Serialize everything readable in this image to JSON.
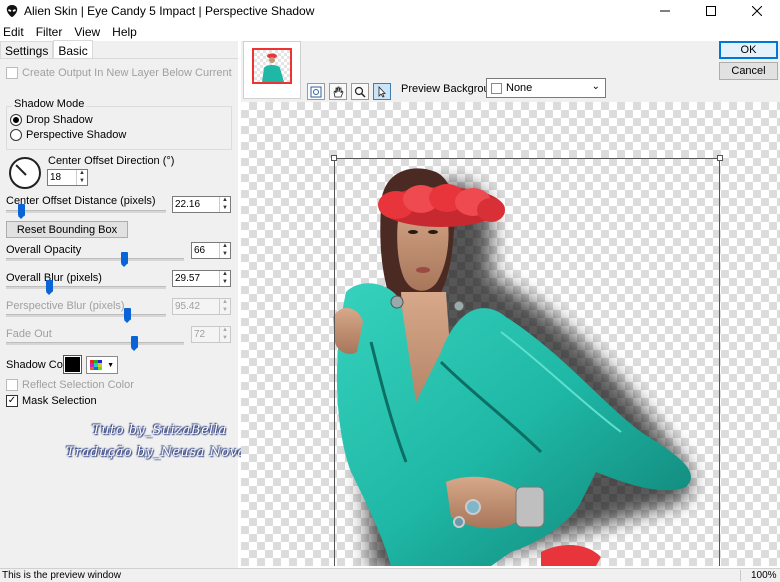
{
  "window": {
    "title": "Alien Skin | Eye Candy 5 Impact | Perspective Shadow",
    "minimize_icon": "minimize-icon",
    "maximize_icon": "maximize-icon",
    "close_icon": "close-icon"
  },
  "menu": [
    "Edit",
    "Filter",
    "View",
    "Help"
  ],
  "tabs": {
    "settings": "Settings",
    "basic": "Basic"
  },
  "basic": {
    "create_output_label": "Create Output In New Layer Below Current",
    "shadow_mode_legend": "Shadow Mode",
    "drop_shadow_label": "Drop Shadow",
    "perspective_shadow_label": "Perspective Shadow",
    "selected_mode": "Drop Shadow",
    "center_offset_direction_label": "Center Offset Direction (°)",
    "center_offset_direction_value": "18",
    "center_offset_distance_label": "Center Offset Distance (pixels)",
    "center_offset_distance_value": "22.16",
    "center_offset_distance_level": 0.1,
    "reset_bbox_label": "Reset Bounding Box",
    "overall_opacity_label": "Overall Opacity",
    "overall_opacity_value": "66",
    "overall_opacity_level": 0.66,
    "overall_blur_label": "Overall Blur (pixels)",
    "overall_blur_value": "29.57",
    "overall_blur_level": 0.28,
    "perspective_blur_label": "Perspective Blur (pixels)",
    "perspective_blur_value": "95.42",
    "perspective_blur_level": 0.75,
    "fade_out_label": "Fade Out",
    "fade_out_value": "72",
    "fade_out_level": 0.72,
    "shadow_color_label": "Shadow Color",
    "shadow_color": "#000000",
    "reflect_selection_color_label": "Reflect Selection Color",
    "mask_selection_label": "Mask Selection",
    "mask_selection_checked": true
  },
  "watermark": {
    "line1": "Tuto by_SuizaBella",
    "line2": "Tradução by_Neusa Novaes"
  },
  "preview_header": {
    "preview_background_label": "Preview Background:",
    "preview_background_value": "None",
    "ok_label": "OK",
    "cancel_label": "Cancel",
    "tools": [
      "zoom-fit-icon",
      "hand-icon",
      "magnifier-icon",
      "pointer-icon"
    ],
    "active_tool": "pointer-icon"
  },
  "status": {
    "text": "This is the preview window",
    "zoom": "100%"
  },
  "colors": {
    "accent": "#0078d7",
    "slider_thumb": "#0a64d6",
    "headband_red": "#e8353b",
    "jacket_teal": "#1fb8a6",
    "watermark_outline": "#2a3b7c"
  }
}
